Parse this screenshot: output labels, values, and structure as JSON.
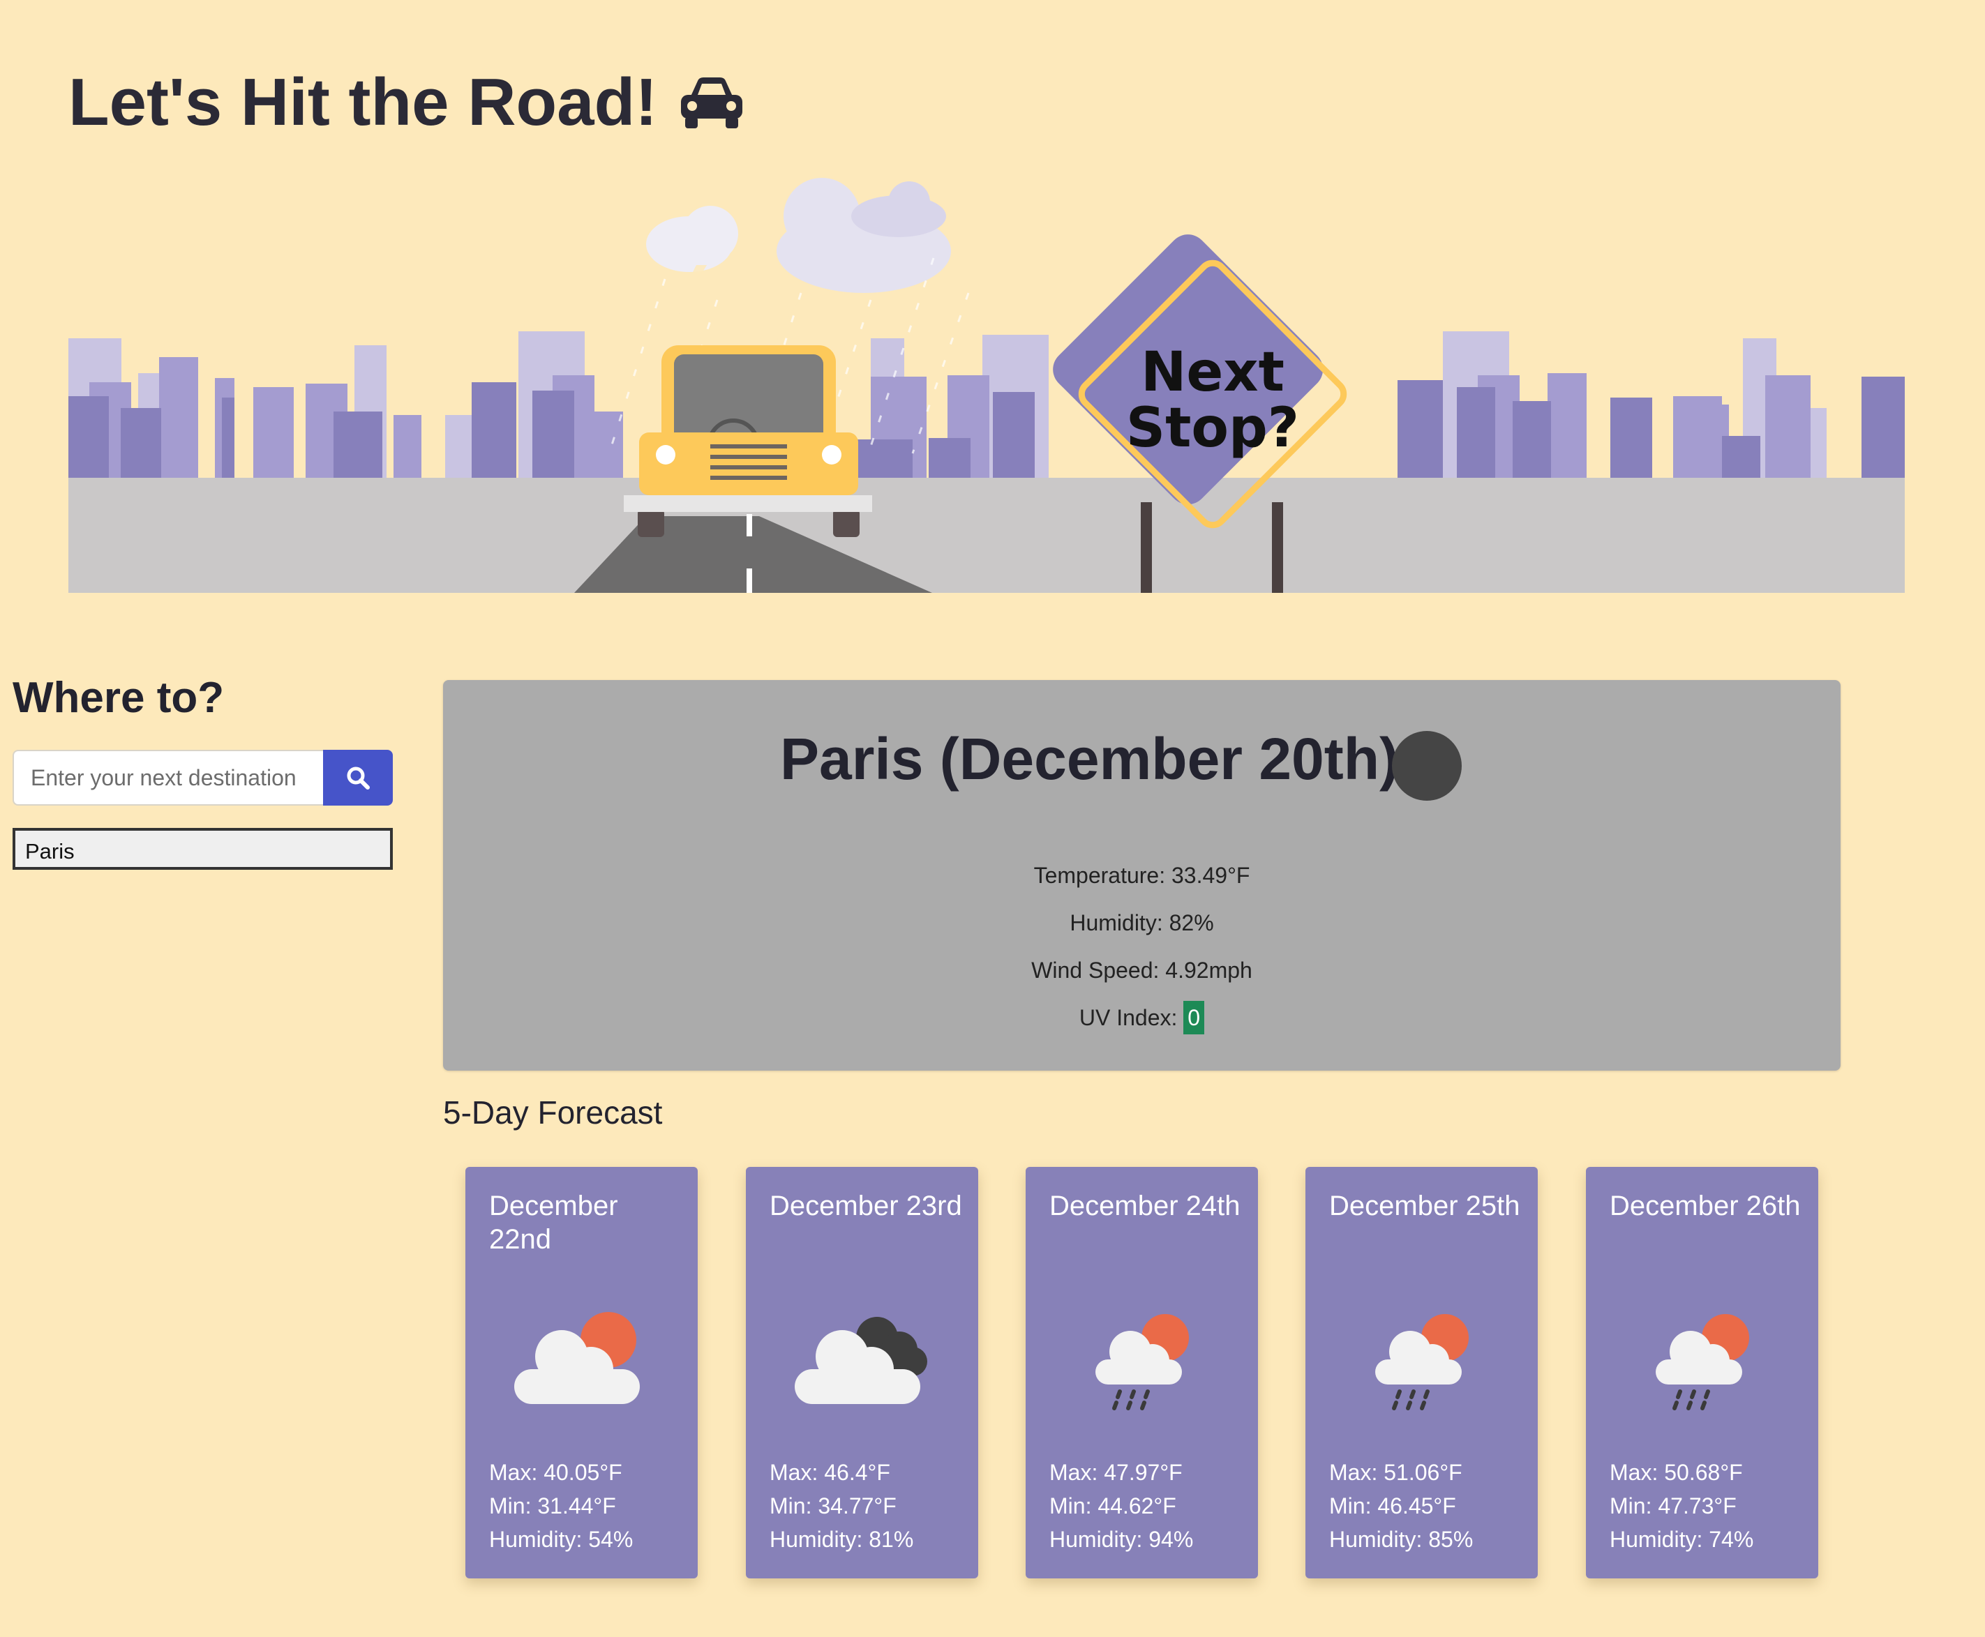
{
  "header": {
    "title": "Let's Hit the Road!",
    "icon": "car-icon"
  },
  "banner": {
    "sign_line1": "Next",
    "sign_line2": "Stop?"
  },
  "search": {
    "heading": "Where to?",
    "placeholder": "Enter your next destination",
    "button_icon": "search-icon",
    "history": [
      "Paris"
    ]
  },
  "current": {
    "city_date": "Paris (December 20th)",
    "icon": "night-clear-icon",
    "temperature": "Temperature: 33.49°F",
    "humidity": "Humidity: 82%",
    "wind": "Wind Speed: 4.92mph",
    "uv_label": "UV Index:",
    "uv_value": "0",
    "uv_color": "#1d8a56"
  },
  "forecast": {
    "heading": "5-Day Forecast",
    "days": [
      {
        "date": "December 22nd",
        "icon": "cloud-sun-icon",
        "max": "Max: 40.05°F",
        "min": "Min: 31.44°F",
        "humidity": "Humidity: 54%"
      },
      {
        "date": "December 23rd",
        "icon": "clouds-icon",
        "max": "Max: 46.4°F",
        "min": "Min: 34.77°F",
        "humidity": "Humidity: 81%"
      },
      {
        "date": "December 24th",
        "icon": "rain-sun-icon",
        "max": "Max: 47.97°F",
        "min": "Min: 44.62°F",
        "humidity": "Humidity: 94%"
      },
      {
        "date": "December 25th",
        "icon": "rain-sun-icon",
        "max": "Max: 51.06°F",
        "min": "Min: 46.45°F",
        "humidity": "Humidity: 85%"
      },
      {
        "date": "December 26th",
        "icon": "rain-sun-icon",
        "max": "Max: 50.68°F",
        "min": "Min: 47.73°F",
        "humidity": "Humidity: 74%"
      }
    ]
  },
  "colors": {
    "background": "#fde9bb",
    "card": "#8781b8",
    "button": "#4654c9",
    "current_panel": "#ababab"
  }
}
